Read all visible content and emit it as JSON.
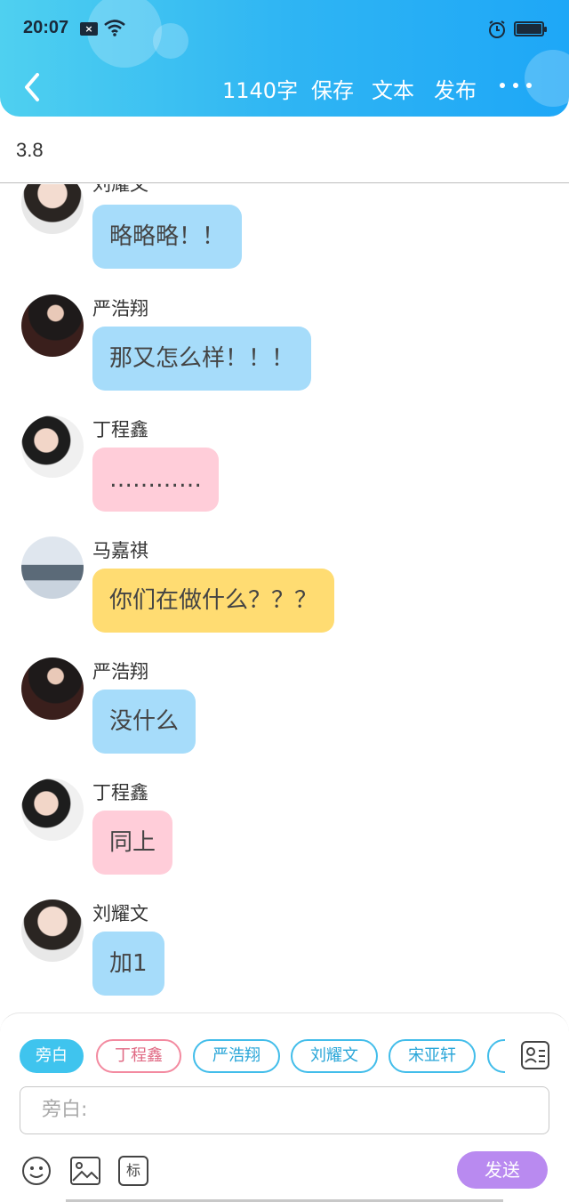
{
  "status_bar": {
    "time": "20:07"
  },
  "header": {
    "word_count": "1140字",
    "save": "保存",
    "text": "文本",
    "publish": "发布"
  },
  "title": "3.8",
  "messages": [
    {
      "name": "刘耀文",
      "text": "略略略！！",
      "color": "blue"
    },
    {
      "name": "严浩翔",
      "text": "那又怎么样！！！",
      "color": "blue"
    },
    {
      "name": "丁程鑫",
      "text": "…………",
      "color": "pink"
    },
    {
      "name": "马嘉祺",
      "text": "你们在做什么？？？",
      "color": "yellow"
    },
    {
      "name": "严浩翔",
      "text": "没什么",
      "color": "blue"
    },
    {
      "name": "丁程鑫",
      "text": "同上",
      "color": "pink"
    },
    {
      "name": "刘耀文",
      "text": "加1",
      "color": "blue"
    }
  ],
  "composer": {
    "chips": [
      "旁白",
      "丁程鑫",
      "严浩翔",
      "刘耀文",
      "宋亚轩"
    ],
    "input_placeholder": "旁白:",
    "tag_label": "标",
    "send_label": "发送"
  },
  "colors": {
    "header_gradient_start": "#4fd0f0",
    "header_gradient_end": "#1ea7f7",
    "bubble_blue": "#a6dcfa",
    "bubble_pink": "#ffcdd9",
    "bubble_yellow": "#ffdc72",
    "send_button": "#b98af0"
  }
}
